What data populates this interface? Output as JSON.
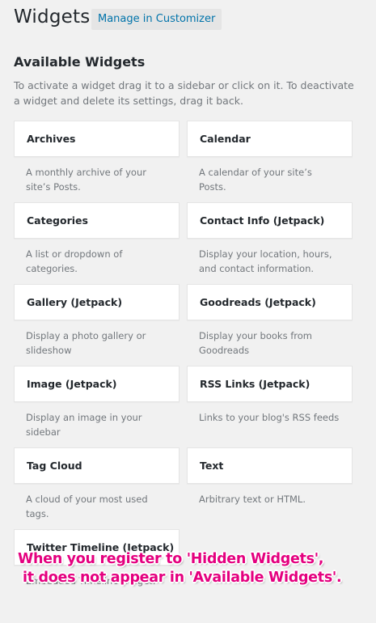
{
  "header": {
    "title": "Widgets",
    "customizer_button": "Manage in Customizer"
  },
  "available": {
    "title": "Available Widgets",
    "description": "To activate a widget drag it to a sidebar or click on it. To deactivate a widget and delete its settings, drag it back."
  },
  "widgets": [
    {
      "title": "Archives",
      "description": "A monthly archive of your site’s Posts."
    },
    {
      "title": "Calendar",
      "description": "A calendar of your site’s Posts."
    },
    {
      "title": "Categories",
      "description": "A list or dropdown of categories."
    },
    {
      "title": "Contact Info (Jetpack)",
      "description": "Display your location, hours, and contact information."
    },
    {
      "title": "Gallery (Jetpack)",
      "description": "Display a photo gallery or slideshow"
    },
    {
      "title": "Goodreads (Jetpack)",
      "description": "Display your books from Goodreads"
    },
    {
      "title": "Image (Jetpack)",
      "description": "Display an image in your sidebar"
    },
    {
      "title": "RSS Links (Jetpack)",
      "description": "Links to your blog's RSS feeds"
    },
    {
      "title": "Tag Cloud",
      "description": "A cloud of your most used tags."
    },
    {
      "title": "Text",
      "description": "Arbitrary text or HTML."
    },
    {
      "title": "Twitter Timeline (Jetpack)",
      "description": "Embedded Timeline widget."
    }
  ],
  "annotation": {
    "line1": "When you register to 'Hidden Widgets',",
    "line2": "it does not appear in 'Available Widgets'.",
    "color": "#e4007f"
  }
}
